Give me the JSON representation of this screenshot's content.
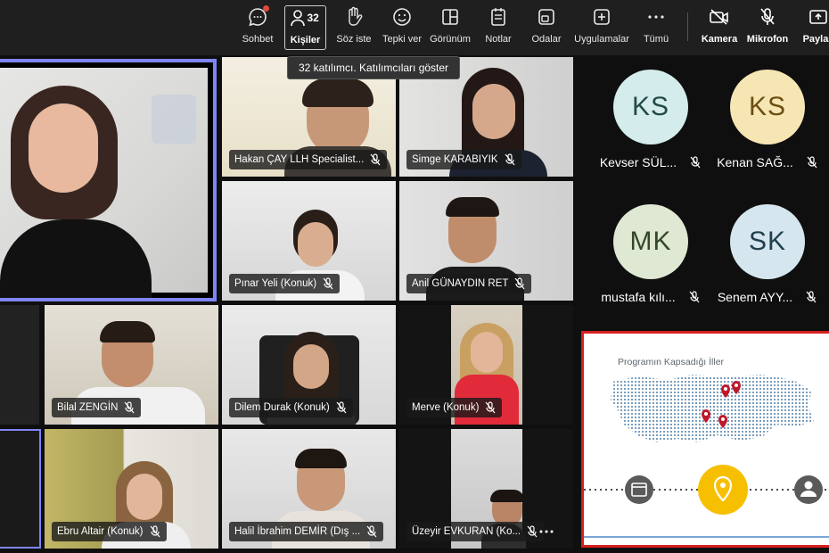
{
  "toolbar": {
    "items": [
      {
        "id": "chat",
        "label": "Sohbet",
        "icon": "chat-icon"
      },
      {
        "id": "people",
        "label": "Kişiler",
        "icon": "people-icon",
        "count": "32"
      },
      {
        "id": "raise",
        "label": "Söz iste",
        "icon": "raise-hand-icon"
      },
      {
        "id": "react",
        "label": "Tepki ver",
        "icon": "reaction-icon"
      },
      {
        "id": "view",
        "label": "Görünüm",
        "icon": "view-icon"
      },
      {
        "id": "notes",
        "label": "Notlar",
        "icon": "notes-icon"
      },
      {
        "id": "rooms",
        "label": "Odalar",
        "icon": "rooms-icon"
      },
      {
        "id": "apps",
        "label": "Uygulamalar",
        "icon": "apps-icon"
      },
      {
        "id": "more",
        "label": "Tümü",
        "icon": "more-icon"
      },
      {
        "id": "camera",
        "label": "Kamera",
        "icon": "camera-off-icon"
      },
      {
        "id": "mic",
        "label": "Mikrofon",
        "icon": "mic-off-icon"
      },
      {
        "id": "share",
        "label": "Paylaş",
        "icon": "share-icon"
      }
    ],
    "tooltip": "32 katılımcı. Katılımcıları göster"
  },
  "participants": [
    {
      "name": "Hakan ÇAY LLH Specialist..."
    },
    {
      "name": "Simge KARABIYIK"
    },
    {
      "name": "Pınar Yeli (Konuk)"
    },
    {
      "name": "Anil GÜNAYDIN RET"
    },
    {
      "name": "Bilal ZENGİN"
    },
    {
      "name": "Dilem Durak (Konuk)"
    },
    {
      "name": "Merve (Konuk)"
    },
    {
      "name": "Ebru Altair (Konuk)"
    },
    {
      "name": "Halil İbrahim DEMİR (Dış ..."
    },
    {
      "name": "Üzeyir EVKURAN (Ko..."
    }
  ],
  "avatars": [
    {
      "initials": "KS",
      "name": "Kevser SÜL...",
      "color": "#d4ecec"
    },
    {
      "initials": "KS",
      "name": "Kenan SAĞ...",
      "color": "#f6e6b4"
    },
    {
      "initials": "MK",
      "name": "mustafa kılı...",
      "color": "#dfe8d2"
    },
    {
      "initials": "SK",
      "name": "Senem AYY...",
      "color": "#d6e6ee"
    }
  ],
  "shared_content": {
    "title": "Programın Kapsadığı İller",
    "accent_color": "#f6c000",
    "border_color": "#d6201f"
  }
}
